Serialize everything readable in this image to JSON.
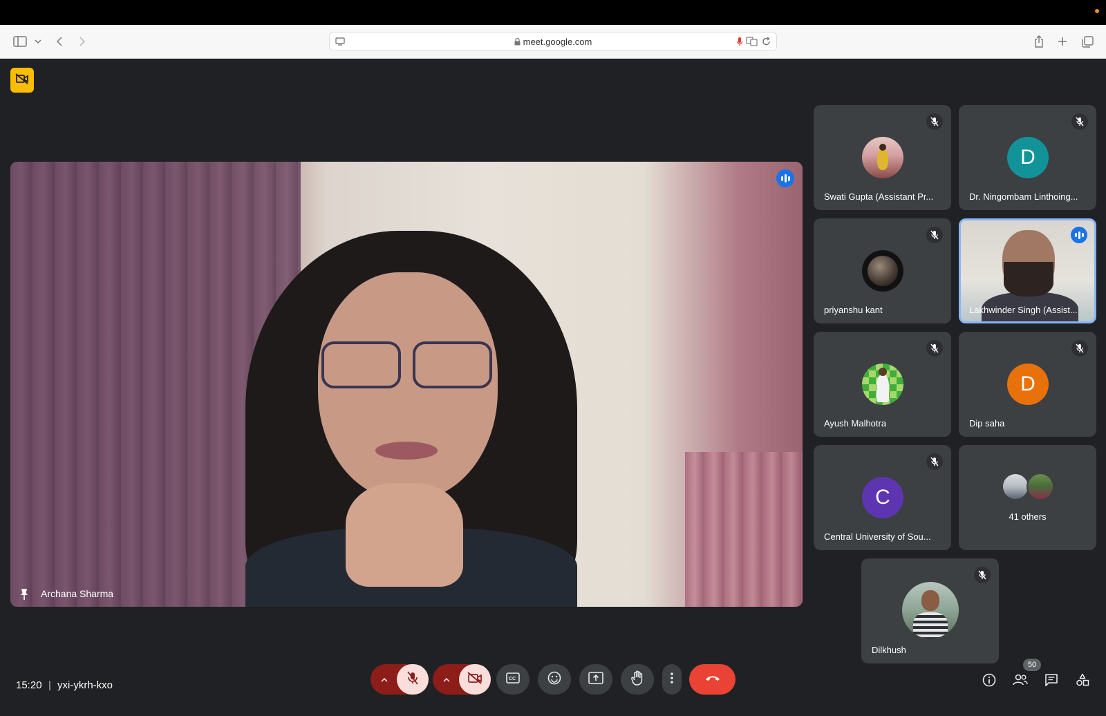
{
  "browser": {
    "url": "meet.google.com"
  },
  "main_video": {
    "name": "Archana Sharma"
  },
  "tiles": [
    {
      "name": "Swati Gupta (Assistant Pr...",
      "avatar_letter": "",
      "avatar_color": "#b0806a"
    },
    {
      "name": "Dr. Ningombam Linthoing...",
      "avatar_letter": "D",
      "avatar_color": "#12939a"
    },
    {
      "name": "priyanshu kant",
      "avatar_letter": "",
      "avatar_color": "#1b1b1b"
    },
    {
      "name": "Lakhwinder Singh (Assist...",
      "avatar_letter": "",
      "avatar_color": ""
    },
    {
      "name": "Ayush Malhotra",
      "avatar_letter": "",
      "avatar_color": "#4caf50"
    },
    {
      "name": "Dip saha",
      "avatar_letter": "D",
      "avatar_color": "#e8710a"
    },
    {
      "name": "Central University of Sou...",
      "avatar_letter": "C",
      "avatar_color": "#5e35b1"
    },
    {
      "name": "Dilkhush",
      "avatar_letter": "",
      "avatar_color": "#6b7a6c"
    }
  ],
  "others": {
    "label": "41 others"
  },
  "bottom": {
    "time": "15:20",
    "separator": "|",
    "meeting_code": "yxi-ykrh-kxo",
    "participant_count": "50"
  },
  "colors": {
    "background": "#202124",
    "tile": "#3c4043",
    "accent_blue": "#1a73e8",
    "hangup_red": "#ea4335",
    "recording_yellow": "#fbbc04"
  }
}
